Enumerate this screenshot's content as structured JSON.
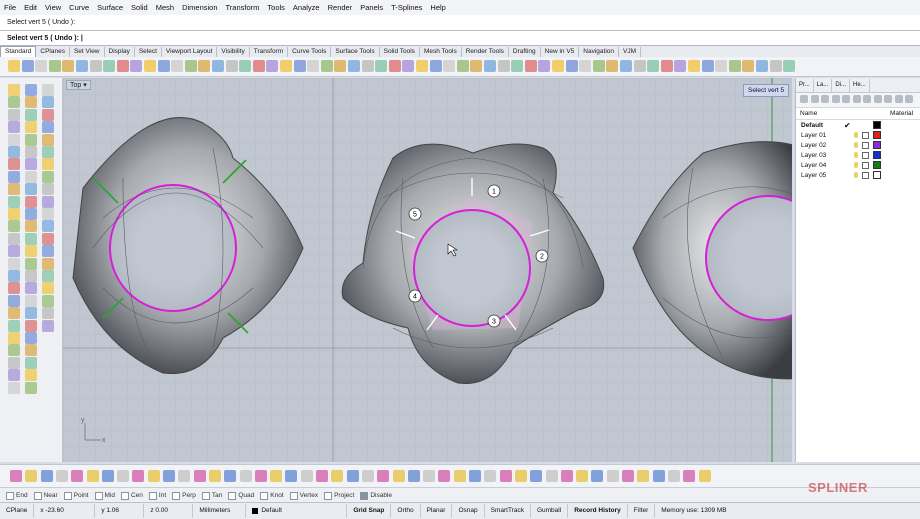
{
  "menu": [
    "File",
    "Edit",
    "View",
    "Curve",
    "Surface",
    "Solid",
    "Mesh",
    "Dimension",
    "Transform",
    "Tools",
    "Analyze",
    "Render",
    "Panels",
    "T-Splines",
    "Help"
  ],
  "command_history": "Select vert 5 ( Undo ):",
  "command_prompt": "Select vert 5 ( Undo ): |",
  "toolbar_tabs": [
    "Standard",
    "CPlanes",
    "Set View",
    "Display",
    "Select",
    "Viewport Layout",
    "Visibility",
    "Transform",
    "Curve Tools",
    "Surface Tools",
    "Solid Tools",
    "Mesh Tools",
    "Render Tools",
    "Drafting",
    "New in V5",
    "Navigation",
    "VJM"
  ],
  "viewport": {
    "name": "Top",
    "tooltip": "Select vert 5",
    "markers": [
      "1",
      "2",
      "3",
      "4",
      "5"
    ],
    "axis_y": "y",
    "axis_x": "x"
  },
  "right_panel": {
    "tabs": [
      "Pr...",
      "La...",
      "Di...",
      "He..."
    ],
    "columns": {
      "name": "Name",
      "material": "Material"
    },
    "layers": [
      {
        "name": "Default",
        "current": true,
        "color": "#000000"
      },
      {
        "name": "Layer 01",
        "current": false,
        "color": "#e02020"
      },
      {
        "name": "Layer 02",
        "current": false,
        "color": "#8a2be2"
      },
      {
        "name": "Layer 03",
        "current": false,
        "color": "#1030d0"
      },
      {
        "name": "Layer 04",
        "current": false,
        "color": "#108010"
      },
      {
        "name": "Layer 05",
        "current": false,
        "color": "#ffffff"
      }
    ],
    "current_mark": "✔"
  },
  "osnaps": [
    "End",
    "Near",
    "Point",
    "Mid",
    "Cen",
    "Int",
    "Perp",
    "Tan",
    "Quad",
    "Knot",
    "Vertex",
    "Project",
    "Disable"
  ],
  "status": {
    "cplane": "CPlane",
    "x": "x -23.60",
    "y": "y 1.06",
    "z": "z 0.00",
    "units": "Millimeters",
    "layer": "Default",
    "grid_snap": "Grid Snap",
    "ortho": "Ortho",
    "planar": "Planar",
    "osnap": "Osnap",
    "smarttrack": "SmartTrack",
    "gumball": "Gumball",
    "record_history": "Record History",
    "filter": "Filter",
    "memory": "Memory use: 1309 MB"
  },
  "watermark": "SPLINER"
}
